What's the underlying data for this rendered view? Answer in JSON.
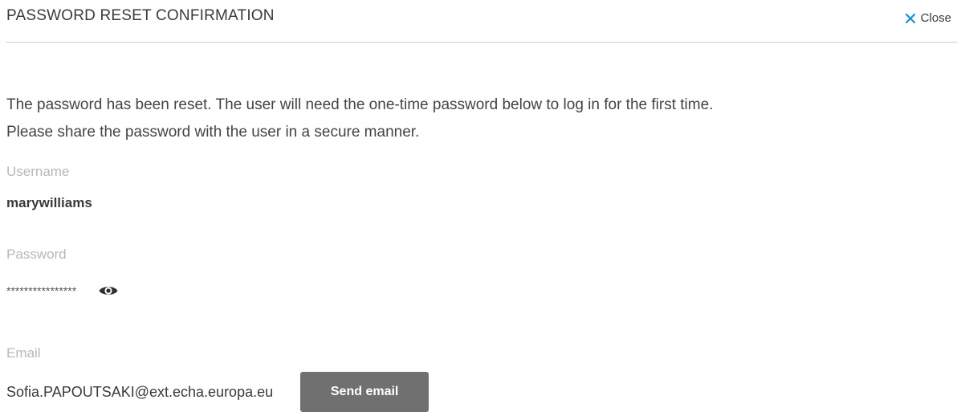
{
  "dialog": {
    "title": "PASSWORD RESET CONFIRMATION",
    "close_label": "Close",
    "close_icon": "close-x-icon",
    "accent_color": "#1a8fd6"
  },
  "message": {
    "line1": "The password has been reset. The user will need the one-time password below to log in for the first time.",
    "line2": "Please share the password with the user in a secure manner."
  },
  "fields": {
    "username": {
      "label": "Username",
      "value": "marywilliams"
    },
    "password": {
      "label": "Password",
      "value": "****************",
      "reveal_icon": "eye-icon"
    },
    "email": {
      "label": "Email",
      "value": "Sofia.PAPOUTSAKI@ext.echa.europa.eu",
      "button_label": "Send email"
    }
  }
}
